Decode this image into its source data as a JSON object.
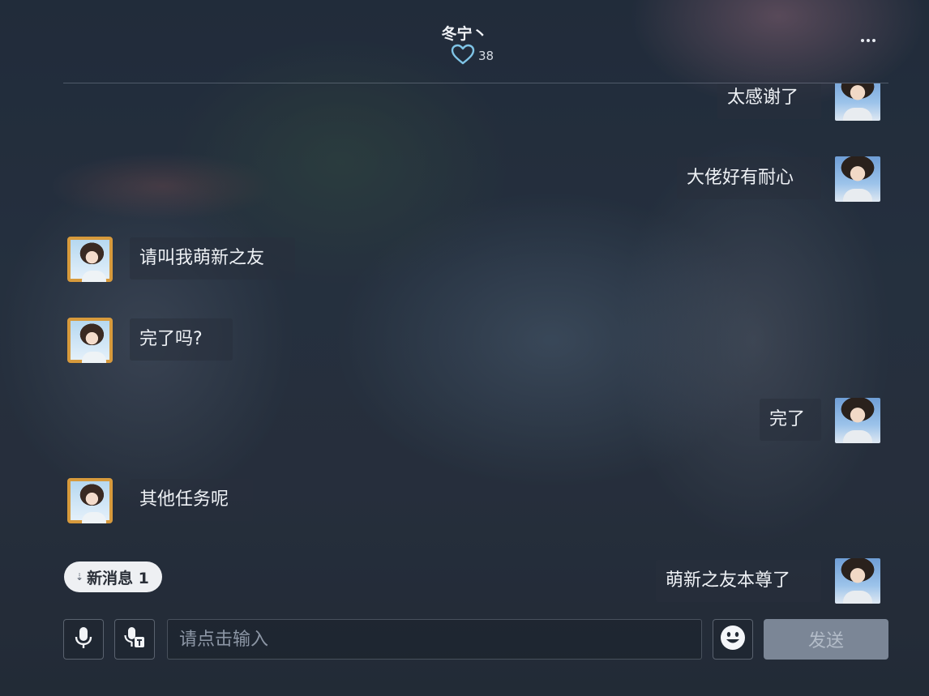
{
  "header": {
    "title": "冬宁丶",
    "likes_count": "38"
  },
  "messages": [
    {
      "side": "right",
      "text": "太感谢了"
    },
    {
      "side": "right",
      "text": "大佬好有耐心"
    },
    {
      "side": "left",
      "text": "请叫我萌新之友"
    },
    {
      "side": "left",
      "text": "完了吗?"
    },
    {
      "side": "right",
      "text": "完了"
    },
    {
      "side": "left",
      "text": "其他任务呢"
    },
    {
      "side": "right",
      "text": "萌新之友本尊了"
    }
  ],
  "new_message_badge": {
    "label": "新消息 1"
  },
  "input": {
    "placeholder": "请点击输入",
    "value": "",
    "send_label": "发送"
  },
  "colors": {
    "send_button_disabled": "#7b8696",
    "left_avatar_frame": "#d79a3c"
  },
  "icons": {
    "likes": "heart-outline-icon",
    "more": "more-dots-icon",
    "voice": "microphone-icon",
    "voice_to_text": "microphone-text-icon",
    "emoji": "emoji-icon",
    "new_messages": "chevron-double-down-icon"
  }
}
